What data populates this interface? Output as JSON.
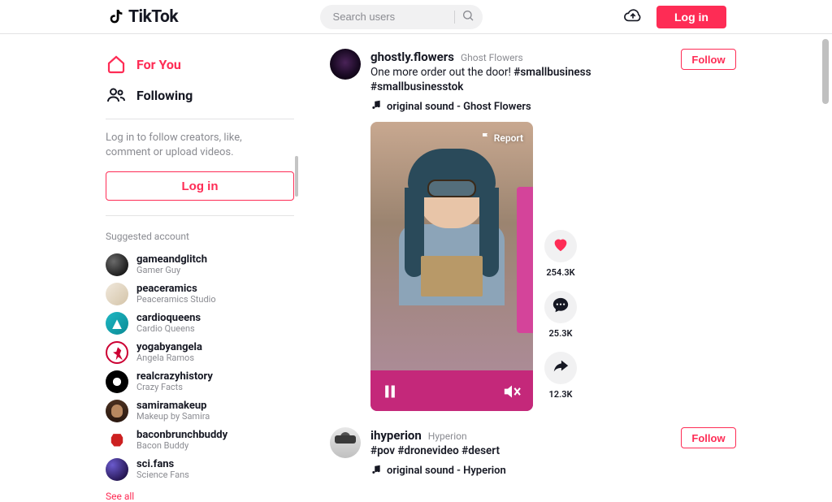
{
  "brand": "TikTok",
  "header": {
    "search_placeholder": "Search users",
    "login_label": "Log in"
  },
  "sidebar": {
    "nav": {
      "forYou": "For You",
      "following": "Following"
    },
    "login_prompt": "Log in to follow creators, like, comment or upload videos.",
    "login_button": "Log in",
    "suggested_title": "Suggested account",
    "see_all": "See all",
    "accounts": [
      {
        "username": "gameandglitch",
        "display": "Gamer Guy",
        "avatar": "av-gg"
      },
      {
        "username": "peaceramics",
        "display": "Peaceramics Studio",
        "avatar": "av-pc"
      },
      {
        "username": "cardioqueens",
        "display": "Cardio Queens",
        "avatar": "av-cq"
      },
      {
        "username": "yogabyangela",
        "display": "Angela Ramos",
        "avatar": "av-ya"
      },
      {
        "username": "realcrazyhistory",
        "display": "Crazy Facts",
        "avatar": "av-rh"
      },
      {
        "username": "samiramakeup",
        "display": "Makeup by Samira",
        "avatar": "av-sm"
      },
      {
        "username": "baconbrunchbuddy",
        "display": "Bacon Buddy",
        "avatar": "av-bb"
      },
      {
        "username": "sci.fans",
        "display": "Science Fans",
        "avatar": "av-sf"
      }
    ]
  },
  "feed": {
    "follow_label": "Follow",
    "report_label": "Report",
    "posts": [
      {
        "username": "ghostly.flowers",
        "display": "Ghost Flowers",
        "caption_text": "One more order out the door! ",
        "tags": [
          "#smallbusiness",
          "#smallbusinesstok"
        ],
        "sound": "original sound - Ghost Flowers",
        "likes": "254.3K",
        "comments": "25.3K",
        "shares": "12.3K",
        "avatar": "av-gh"
      },
      {
        "username": "ihyperion",
        "display": "Hyperion",
        "caption_text": "",
        "tags": [
          "#pov",
          "#dronevideo",
          "#desert"
        ],
        "sound": "original sound - Hyperion",
        "avatar": "av-ih"
      }
    ]
  },
  "colors": {
    "accent": "#fe2c55"
  }
}
